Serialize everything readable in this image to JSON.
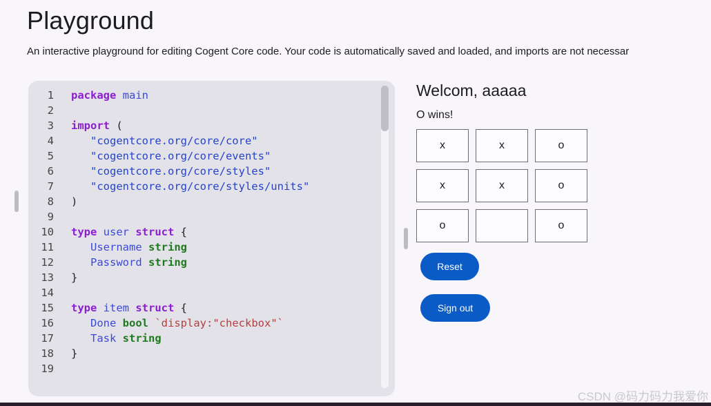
{
  "page": {
    "title": "Playground",
    "description": "An interactive playground for editing Cogent Core code. Your code is automatically saved and loaded, and imports are not necessar"
  },
  "editor": {
    "lines": [
      {
        "n": "1",
        "tokens": [
          {
            "t": "package",
            "c": "kw"
          },
          {
            "t": " ",
            "c": "pl"
          },
          {
            "t": "main",
            "c": "nm"
          }
        ]
      },
      {
        "n": "2",
        "tokens": []
      },
      {
        "n": "3",
        "tokens": [
          {
            "t": "import",
            "c": "kw"
          },
          {
            "t": " (",
            "c": "pl"
          }
        ]
      },
      {
        "n": "4",
        "tokens": [
          {
            "t": "   ",
            "c": "pl"
          },
          {
            "t": "\"cogentcore.org/core/core\"",
            "c": "str"
          }
        ]
      },
      {
        "n": "5",
        "tokens": [
          {
            "t": "   ",
            "c": "pl"
          },
          {
            "t": "\"cogentcore.org/core/events\"",
            "c": "str"
          }
        ]
      },
      {
        "n": "6",
        "tokens": [
          {
            "t": "   ",
            "c": "pl"
          },
          {
            "t": "\"cogentcore.org/core/styles\"",
            "c": "str"
          }
        ]
      },
      {
        "n": "7",
        "tokens": [
          {
            "t": "   ",
            "c": "pl"
          },
          {
            "t": "\"cogentcore.org/core/styles/units\"",
            "c": "str"
          }
        ]
      },
      {
        "n": "8",
        "tokens": [
          {
            "t": ")",
            "c": "pl"
          }
        ]
      },
      {
        "n": "9",
        "tokens": []
      },
      {
        "n": "10",
        "tokens": [
          {
            "t": "type",
            "c": "kw"
          },
          {
            "t": " ",
            "c": "pl"
          },
          {
            "t": "user",
            "c": "nm"
          },
          {
            "t": " ",
            "c": "pl"
          },
          {
            "t": "struct",
            "c": "kw"
          },
          {
            "t": " {",
            "c": "pl"
          }
        ]
      },
      {
        "n": "11",
        "tokens": [
          {
            "t": "   ",
            "c": "pl"
          },
          {
            "t": "Username",
            "c": "nm"
          },
          {
            "t": " ",
            "c": "pl"
          },
          {
            "t": "string",
            "c": "ty"
          }
        ]
      },
      {
        "n": "12",
        "tokens": [
          {
            "t": "   ",
            "c": "pl"
          },
          {
            "t": "Password",
            "c": "nm"
          },
          {
            "t": " ",
            "c": "pl"
          },
          {
            "t": "string",
            "c": "ty"
          }
        ]
      },
      {
        "n": "13",
        "tokens": [
          {
            "t": "}",
            "c": "pl"
          }
        ]
      },
      {
        "n": "14",
        "tokens": []
      },
      {
        "n": "15",
        "tokens": [
          {
            "t": "type",
            "c": "kw"
          },
          {
            "t": " ",
            "c": "pl"
          },
          {
            "t": "item",
            "c": "nm"
          },
          {
            "t": " ",
            "c": "pl"
          },
          {
            "t": "struct",
            "c": "kw"
          },
          {
            "t": " {",
            "c": "pl"
          }
        ]
      },
      {
        "n": "16",
        "tokens": [
          {
            "t": "   ",
            "c": "pl"
          },
          {
            "t": "Done",
            "c": "nm"
          },
          {
            "t": " ",
            "c": "pl"
          },
          {
            "t": "bool",
            "c": "ty"
          },
          {
            "t": " ",
            "c": "pl"
          },
          {
            "t": "`display:\"checkbox\"`",
            "c": "raw"
          }
        ]
      },
      {
        "n": "17",
        "tokens": [
          {
            "t": "   ",
            "c": "pl"
          },
          {
            "t": "Task",
            "c": "nm"
          },
          {
            "t": " ",
            "c": "pl"
          },
          {
            "t": "string",
            "c": "ty"
          }
        ]
      },
      {
        "n": "18",
        "tokens": [
          {
            "t": "}",
            "c": "pl"
          }
        ]
      },
      {
        "n": "19",
        "tokens": []
      }
    ]
  },
  "game": {
    "welcome": "Welcom, aaaaa",
    "status": "O wins!",
    "cells": [
      "x",
      "x",
      "o",
      "x",
      "x",
      "o",
      "o",
      "",
      "o"
    ],
    "reset_label": "Reset",
    "signout_label": "Sign out"
  },
  "watermark": "CSDN @码力码力我爱你",
  "colors": {
    "accent": "#0a5bc6",
    "keyword": "#8a1fcf",
    "string": "#2443c9",
    "type": "#1f7a1f",
    "editor_bg": "#e3e2e8"
  }
}
